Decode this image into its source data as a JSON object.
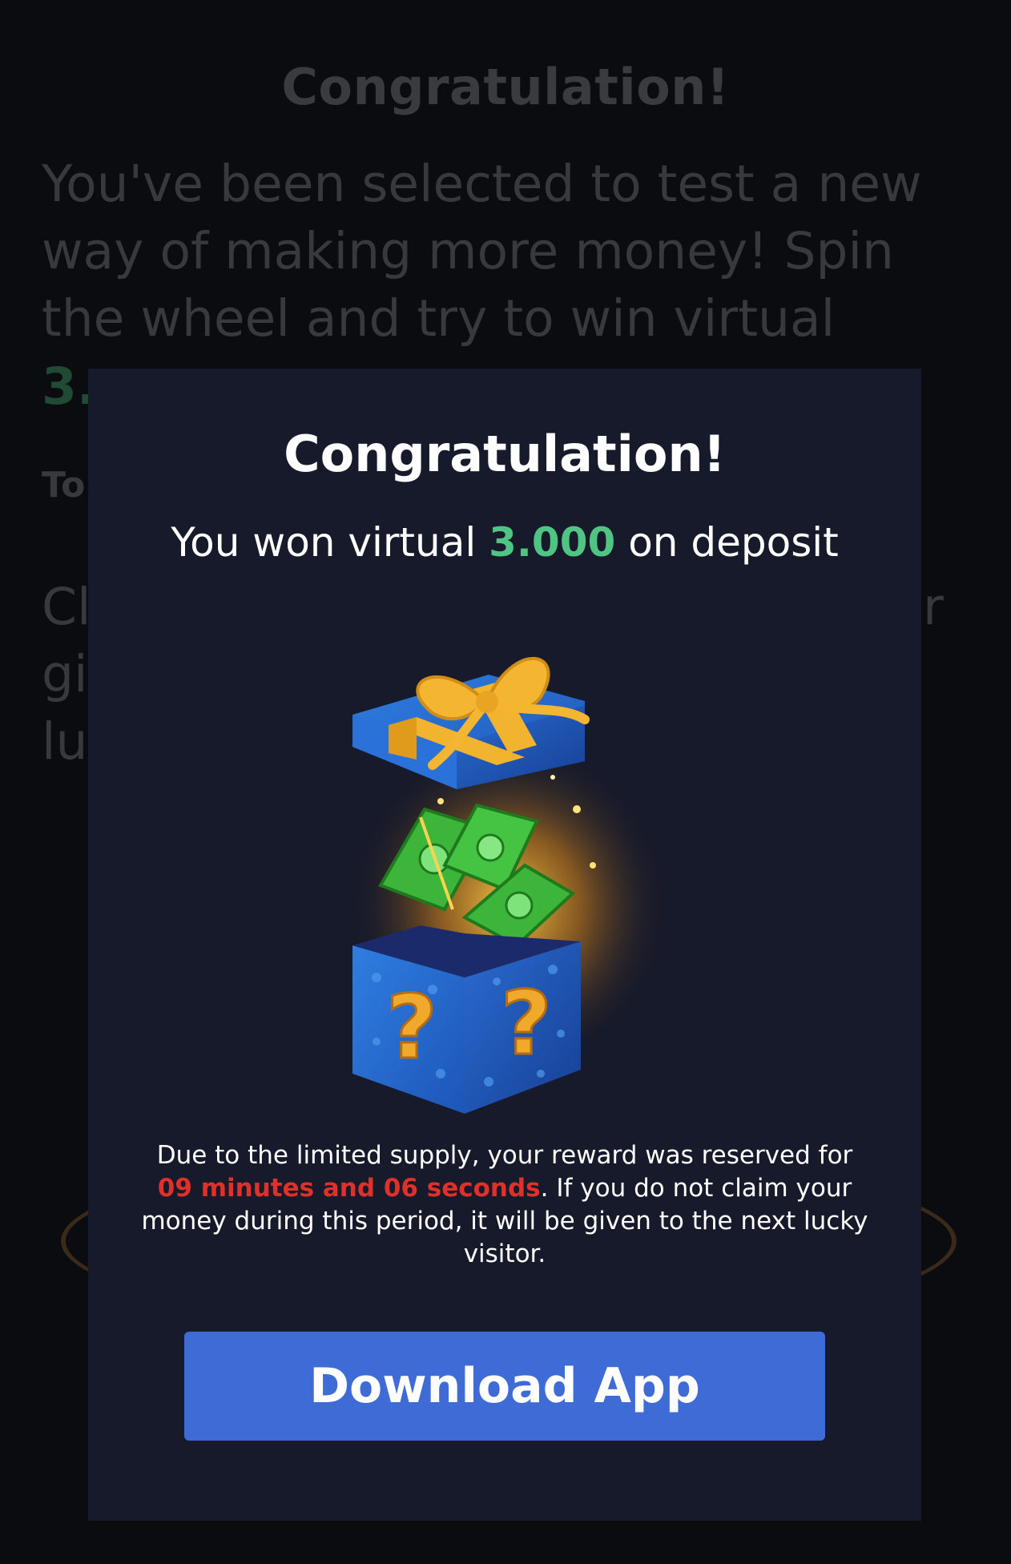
{
  "background": {
    "title": "Congratulation!",
    "paragraph": "You've been selected to test a new way of making more money! Spin the wheel and try to win virtual",
    "amount_partial": "3.",
    "small_label_partial": "To",
    "paragraph2_lines": [
      "Cl",
      "gi",
      "lu"
    ],
    "paragraph2_right_fragment": "r"
  },
  "modal": {
    "title": "Congratulation!",
    "subtitle_prefix": "You won virtual",
    "subtitle_amount": "3.000",
    "subtitle_suffix": "on deposit",
    "notice_prefix": "Due to the limited supply, your reward was reserved for",
    "notice_timer": "09 minutes and 06 seconds",
    "notice_suffix": ". If you do not claim your money during this period, it will be given to the next lucky visitor.",
    "button_label": "Download App"
  },
  "colors": {
    "modal_bg": "#171a2a",
    "accent_green": "#4fc483",
    "timer_red": "#e0302a",
    "button_blue": "#3e6bd6"
  },
  "icons": {
    "gift": "open-gift-box-with-money-icon"
  }
}
